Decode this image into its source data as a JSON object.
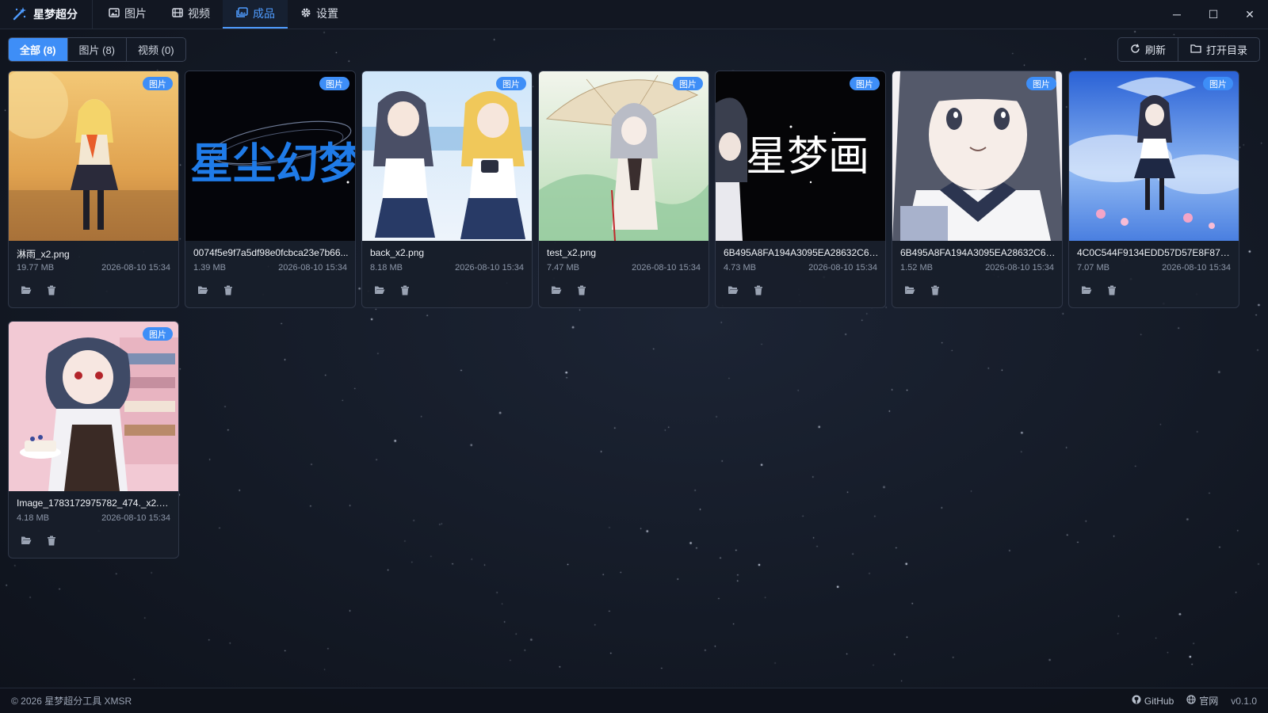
{
  "app": {
    "title": "星梦超分"
  },
  "nav": {
    "tabs": [
      {
        "label": "图片",
        "icon": "image-icon"
      },
      {
        "label": "视频",
        "icon": "film-icon"
      },
      {
        "label": "成品",
        "icon": "gallery-icon",
        "active": true
      },
      {
        "label": "设置",
        "icon": "gear-icon"
      }
    ]
  },
  "window": {
    "minimize": "─",
    "maximize": "☐",
    "close": "✕"
  },
  "filters": [
    {
      "label": "全部 (8)",
      "active": true
    },
    {
      "label": "图片 (8)"
    },
    {
      "label": "视频 (0)"
    }
  ],
  "actions": {
    "refresh": "刷新",
    "open_dir": "打开目录"
  },
  "badge_label": "图片",
  "items": [
    {
      "name": "淋雨_x2.png",
      "size": "19.77 MB",
      "date": "2026-08-10 15:34",
      "badge": "图片"
    },
    {
      "name": "0074f5e9f7a5df98e0fcbca23e7b66...",
      "size": "1.39 MB",
      "date": "2026-08-10 15:34",
      "badge": "图片",
      "thumb_text": "星尘幻梦"
    },
    {
      "name": "back_x2.png",
      "size": "8.18 MB",
      "date": "2026-08-10 15:34",
      "badge": "图片"
    },
    {
      "name": "test_x2.png",
      "size": "7.47 MB",
      "date": "2026-08-10 15:34",
      "badge": "图片"
    },
    {
      "name": "6B495A8FA194A3095EA28632C6B2...",
      "size": "4.73 MB",
      "date": "2026-08-10 15:34",
      "badge": "图片",
      "thumb_text": "星梦画"
    },
    {
      "name": "6B495A8FA194A3095EA28632C6B2...",
      "size": "1.52 MB",
      "date": "2026-08-10 15:34",
      "badge": "图片"
    },
    {
      "name": "4C0C544F9134EDD57D57E8F87DD...",
      "size": "7.07 MB",
      "date": "2026-08-10 15:34",
      "badge": "图片"
    },
    {
      "name": "Image_1783172975782_474._x2.png",
      "size": "4.18 MB",
      "date": "2026-08-10 15:34",
      "badge": "图片"
    }
  ],
  "footer": {
    "copyright": "© 2026 星梦超分工具 XMSR",
    "github": "GitHub",
    "site": "官网",
    "version": "v0.1.0"
  },
  "colors": {
    "accent": "#3e8ef7",
    "background": "#141a26"
  }
}
